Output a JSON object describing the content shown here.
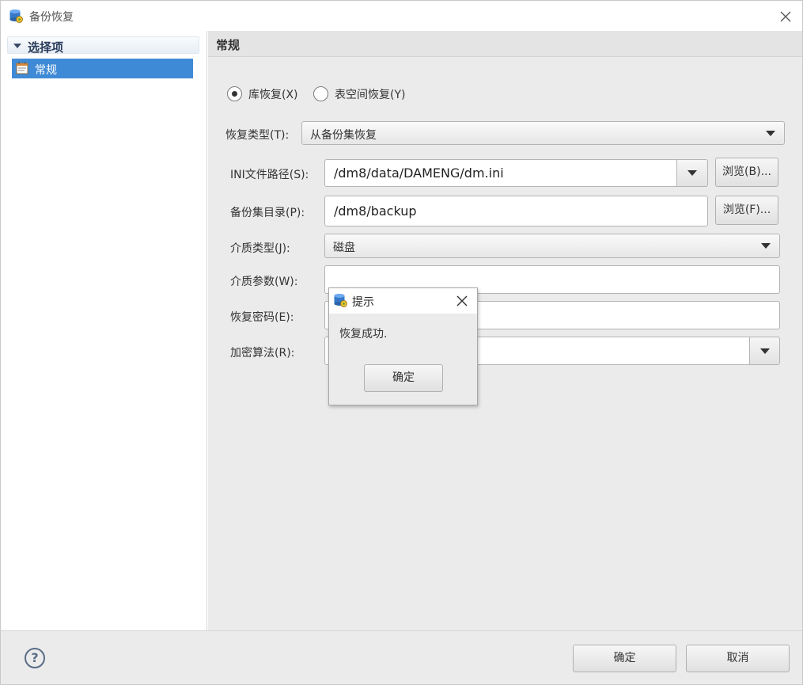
{
  "window": {
    "title": "备份恢复"
  },
  "nav": {
    "group_label": "选择项",
    "items": [
      {
        "label": "常规",
        "selected": true
      }
    ]
  },
  "content": {
    "title": "常规",
    "restore_mode": {
      "options": [
        {
          "label": "库恢复(X)",
          "checked": true
        },
        {
          "label": "表空间恢复(Y)",
          "checked": false
        }
      ]
    },
    "restore_type": {
      "label": "恢复类型(T):",
      "value": "从备份集恢复"
    },
    "ini_path": {
      "label": "INI文件路径(S):",
      "value": "/dm8/data/DAMENG/dm.ini",
      "browse_label": "浏览(B)..."
    },
    "backup_dir": {
      "label": "备份集目录(P):",
      "value": "/dm8/backup",
      "browse_label": "浏览(F)..."
    },
    "media_type": {
      "label": "介质类型(J):",
      "value": "磁盘"
    },
    "media_params": {
      "label": "介质参数(W):",
      "value": ""
    },
    "restore_password": {
      "label": "恢复密码(E):",
      "value": ""
    },
    "encrypt_algorithm": {
      "label": "加密算法(R):",
      "value": ""
    }
  },
  "footer": {
    "ok_label": "确定",
    "cancel_label": "取消",
    "help_symbol": "?"
  },
  "modal": {
    "title": "提示",
    "message": "恢复成功.",
    "ok_label": "确定"
  },
  "icons": {
    "app": "database-icon",
    "nav_item": "settings-page-icon",
    "close": "close-icon",
    "help": "help-icon"
  },
  "colors": {
    "selection": "#3f8ad6",
    "panel_bg": "#ebebeb",
    "nav_group_text": "#2b3d5c"
  }
}
